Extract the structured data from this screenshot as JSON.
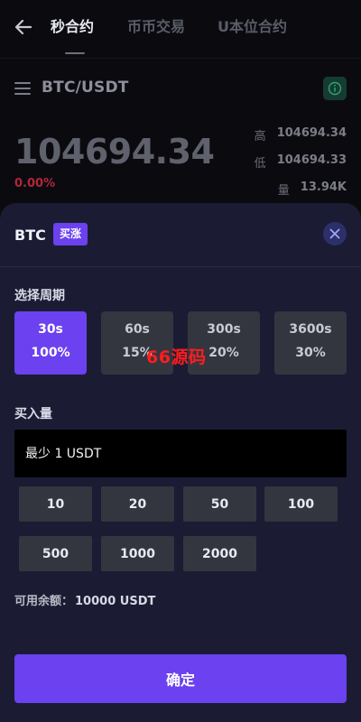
{
  "nav": {
    "tabs": [
      {
        "label": "秒合约",
        "active": true
      },
      {
        "label": "币币交易",
        "active": false
      },
      {
        "label": "U本位合约",
        "active": false
      }
    ]
  },
  "pair": {
    "symbol": "BTC/USDT"
  },
  "ticker": {
    "price": "104694.34",
    "change": "0.00%",
    "high_label": "高",
    "high": "104694.34",
    "low_label": "低",
    "low": "104694.33",
    "volume_label": "量",
    "volume": "13.94K"
  },
  "sheet": {
    "coin": "BTC",
    "direction_badge": "买涨",
    "period_label": "选择周期",
    "periods": [
      {
        "time": "30s",
        "rate": "100%",
        "active": true
      },
      {
        "time": "60s",
        "rate": "15%",
        "active": false
      },
      {
        "time": "300s",
        "rate": "20%",
        "active": false
      },
      {
        "time": "3600s",
        "rate": "30%",
        "active": false
      }
    ],
    "watermark": "66源码",
    "amount_label": "买入量",
    "amount_placeholder": "最少 1 USDT",
    "amount_options": [
      "10",
      "20",
      "50",
      "100",
      "500",
      "1000",
      "2000"
    ],
    "balance_label": "可用余额：",
    "balance_value": "10000 USDT",
    "confirm_label": "确定"
  },
  "colors": {
    "accent": "#6b41f0",
    "sheet_bg": "#1b1c33",
    "down": "#b0263a"
  },
  "icons": {
    "back": "arrow-left-icon",
    "menu": "hamburger-icon",
    "info": "info-icon",
    "close": "close-icon"
  }
}
